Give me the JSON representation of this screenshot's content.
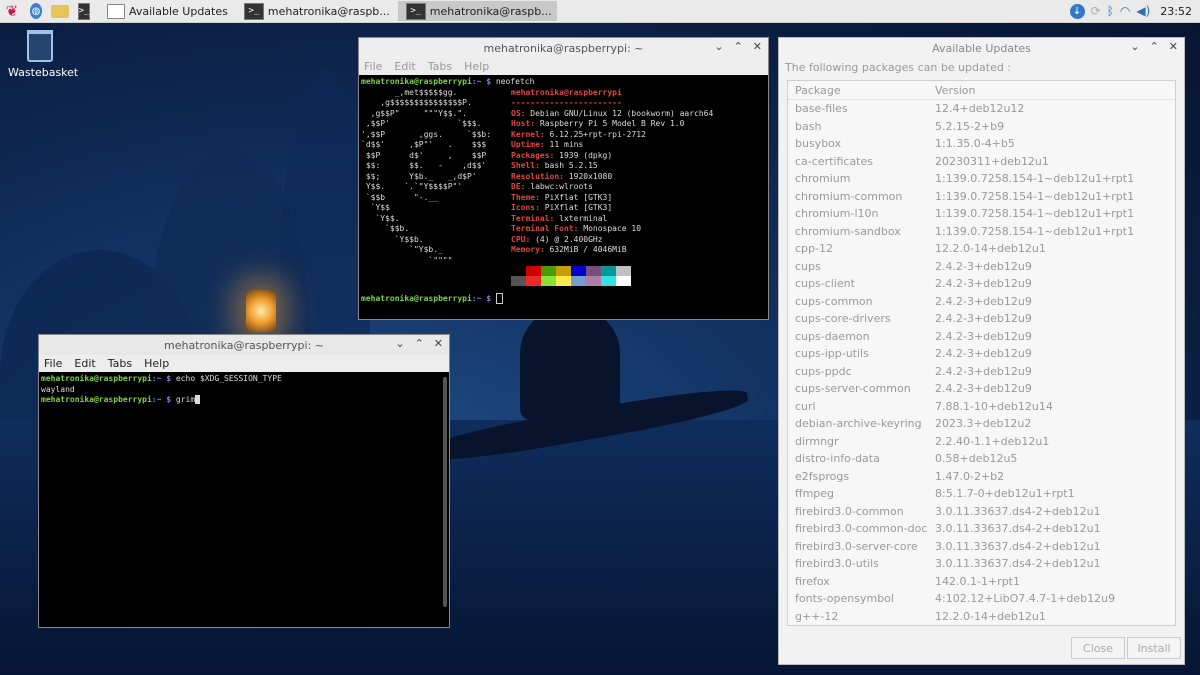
{
  "taskbar": {
    "window_buttons": [
      "Available Updates",
      "mehatronika@raspb...",
      "mehatronika@raspb..."
    ],
    "clock": "23:52"
  },
  "desktop": {
    "wastebasket_label": "Wastebasket"
  },
  "term1": {
    "title": "mehatronika@raspberrypi: ~",
    "menu": [
      "File",
      "Edit",
      "Tabs",
      "Help"
    ],
    "prompt": "mehatronika@raspberrypi",
    "path": ":~ $",
    "command": " neofetch",
    "logo": [
      "       _,met$$$$$gg.",
      "    ,g$$$$$$$$$$$$$$$P.",
      "  ,g$$P\"     \"\"\"Y$$.\".",
      " ,$$P'              `$$$.",
      "',$$P       ,ggs.     `$$b:",
      "`d$$'     ,$P\"'   .    $$$",
      " $$P      d$'     ,    $$P",
      " $$:      $$.   -    ,d$$'",
      " $$;      Y$b._   _,d$P'",
      " Y$$.    `.`\"Y$$$$P\"'",
      " `$$b      \"-.__",
      "  `Y$$",
      "   `Y$$.",
      "     `$$b.",
      "       `Y$$b.",
      "          `\"Y$b._",
      "              `\"\"\"\""
    ],
    "header": "mehatronika@raspberrypi",
    "dashes": "-----------------------",
    "info": [
      {
        "k": "OS",
        "v": " Debian GNU/Linux 12 (bookworm) aarch64"
      },
      {
        "k": "Host",
        "v": " Raspberry Pi 5 Model B Rev 1.0"
      },
      {
        "k": "Kernel",
        "v": " 6.12.25+rpt-rpi-2712"
      },
      {
        "k": "Uptime",
        "v": " 11 mins"
      },
      {
        "k": "Packages",
        "v": " 1939 (dpkg)"
      },
      {
        "k": "Shell",
        "v": " bash 5.2.15"
      },
      {
        "k": "Resolution",
        "v": " 1920x1080"
      },
      {
        "k": "DE",
        "v": " labwc:wlroots"
      },
      {
        "k": "Theme",
        "v": " PiXflat [GTK3]"
      },
      {
        "k": "Icons",
        "v": " PiXflat [GTK3]"
      },
      {
        "k": "Terminal",
        "v": " lxterminal"
      },
      {
        "k": "Terminal Font",
        "v": " Monospace 10"
      },
      {
        "k": "CPU",
        "v": " (4) @ 2.400GHz"
      },
      {
        "k": "Memory",
        "v": " 632MiB / 4046MiB"
      }
    ],
    "palette_top": [
      "#000000",
      "#cc0000",
      "#4e9a06",
      "#c4a000",
      "#0000cc",
      "#75507b",
      "#06989a",
      "#c0c0c0"
    ],
    "palette_bottom": [
      "#555555",
      "#ef2929",
      "#8ae234",
      "#fce94f",
      "#729fcf",
      "#ad7fa8",
      "#34e2e2",
      "#ffffff"
    ]
  },
  "term2": {
    "title": "mehatronika@raspberrypi: ~",
    "menu": [
      "File",
      "Edit",
      "Tabs",
      "Help"
    ],
    "prompt": "mehatronika@raspberrypi",
    "path": ":~ $",
    "cmd1": " echo $XDG_SESSION_TYPE",
    "output1": "wayland",
    "cmd2": " grim"
  },
  "updates": {
    "title": "Available Updates",
    "description": "The following packages can be updated :",
    "col_package": "Package",
    "col_version": "Version",
    "packages": [
      [
        "base-files",
        "12.4+deb12u12"
      ],
      [
        "bash",
        "5.2.15-2+b9"
      ],
      [
        "busybox",
        "1:1.35.0-4+b5"
      ],
      [
        "ca-certificates",
        "20230311+deb12u1"
      ],
      [
        "chromium",
        "1:139.0.7258.154-1~deb12u1+rpt1"
      ],
      [
        "chromium-common",
        "1:139.0.7258.154-1~deb12u1+rpt1"
      ],
      [
        "chromium-l10n",
        "1:139.0.7258.154-1~deb12u1+rpt1"
      ],
      [
        "chromium-sandbox",
        "1:139.0.7258.154-1~deb12u1+rpt1"
      ],
      [
        "cpp-12",
        "12.2.0-14+deb12u1"
      ],
      [
        "cups",
        "2.4.2-3+deb12u9"
      ],
      [
        "cups-client",
        "2.4.2-3+deb12u9"
      ],
      [
        "cups-common",
        "2.4.2-3+deb12u9"
      ],
      [
        "cups-core-drivers",
        "2.4.2-3+deb12u9"
      ],
      [
        "cups-daemon",
        "2.4.2-3+deb12u9"
      ],
      [
        "cups-ipp-utils",
        "2.4.2-3+deb12u9"
      ],
      [
        "cups-ppdc",
        "2.4.2-3+deb12u9"
      ],
      [
        "cups-server-common",
        "2.4.2-3+deb12u9"
      ],
      [
        "curl",
        "7.88.1-10+deb12u14"
      ],
      [
        "debian-archive-keyring",
        "2023.3+deb12u2"
      ],
      [
        "dirmngr",
        "2.2.40-1.1+deb12u1"
      ],
      [
        "distro-info-data",
        "0.58+deb12u5"
      ],
      [
        "e2fsprogs",
        "1.47.0-2+b2"
      ],
      [
        "ffmpeg",
        "8:5.1.7-0+deb12u1+rpt1"
      ],
      [
        "firebird3.0-common",
        "3.0.11.33637.ds4-2+deb12u1"
      ],
      [
        "firebird3.0-common-doc",
        "3.0.11.33637.ds4-2+deb12u1"
      ],
      [
        "firebird3.0-server-core",
        "3.0.11.33637.ds4-2+deb12u1"
      ],
      [
        "firebird3.0-utils",
        "3.0.11.33637.ds4-2+deb12u1"
      ],
      [
        "firefox",
        "142.0.1-1+rpt1"
      ],
      [
        "fonts-opensymbol",
        "4:102.12+LibO7.4.7-1+deb12u9"
      ],
      [
        "g++-12",
        "12.2.0-14+deb12u1"
      ]
    ],
    "close_label": "Close",
    "install_label": "Install"
  }
}
